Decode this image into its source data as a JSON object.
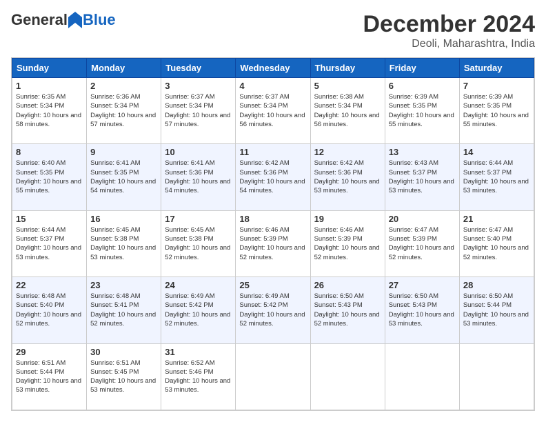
{
  "logo": {
    "general": "General",
    "blue": "Blue"
  },
  "header": {
    "month": "December 2024",
    "location": "Deoli, Maharashtra, India"
  },
  "weekdays": [
    "Sunday",
    "Monday",
    "Tuesday",
    "Wednesday",
    "Thursday",
    "Friday",
    "Saturday"
  ],
  "weeks": [
    [
      {
        "day": "1",
        "sunrise": "6:35 AM",
        "sunset": "5:34 PM",
        "daylight": "10 hours and 58 minutes."
      },
      {
        "day": "2",
        "sunrise": "6:36 AM",
        "sunset": "5:34 PM",
        "daylight": "10 hours and 57 minutes."
      },
      {
        "day": "3",
        "sunrise": "6:37 AM",
        "sunset": "5:34 PM",
        "daylight": "10 hours and 57 minutes."
      },
      {
        "day": "4",
        "sunrise": "6:37 AM",
        "sunset": "5:34 PM",
        "daylight": "10 hours and 56 minutes."
      },
      {
        "day": "5",
        "sunrise": "6:38 AM",
        "sunset": "5:34 PM",
        "daylight": "10 hours and 56 minutes."
      },
      {
        "day": "6",
        "sunrise": "6:39 AM",
        "sunset": "5:35 PM",
        "daylight": "10 hours and 55 minutes."
      },
      {
        "day": "7",
        "sunrise": "6:39 AM",
        "sunset": "5:35 PM",
        "daylight": "10 hours and 55 minutes."
      }
    ],
    [
      {
        "day": "8",
        "sunrise": "6:40 AM",
        "sunset": "5:35 PM",
        "daylight": "10 hours and 55 minutes."
      },
      {
        "day": "9",
        "sunrise": "6:41 AM",
        "sunset": "5:35 PM",
        "daylight": "10 hours and 54 minutes."
      },
      {
        "day": "10",
        "sunrise": "6:41 AM",
        "sunset": "5:36 PM",
        "daylight": "10 hours and 54 minutes."
      },
      {
        "day": "11",
        "sunrise": "6:42 AM",
        "sunset": "5:36 PM",
        "daylight": "10 hours and 54 minutes."
      },
      {
        "day": "12",
        "sunrise": "6:42 AM",
        "sunset": "5:36 PM",
        "daylight": "10 hours and 53 minutes."
      },
      {
        "day": "13",
        "sunrise": "6:43 AM",
        "sunset": "5:37 PM",
        "daylight": "10 hours and 53 minutes."
      },
      {
        "day": "14",
        "sunrise": "6:44 AM",
        "sunset": "5:37 PM",
        "daylight": "10 hours and 53 minutes."
      }
    ],
    [
      {
        "day": "15",
        "sunrise": "6:44 AM",
        "sunset": "5:37 PM",
        "daylight": "10 hours and 53 minutes."
      },
      {
        "day": "16",
        "sunrise": "6:45 AM",
        "sunset": "5:38 PM",
        "daylight": "10 hours and 53 minutes."
      },
      {
        "day": "17",
        "sunrise": "6:45 AM",
        "sunset": "5:38 PM",
        "daylight": "10 hours and 52 minutes."
      },
      {
        "day": "18",
        "sunrise": "6:46 AM",
        "sunset": "5:39 PM",
        "daylight": "10 hours and 52 minutes."
      },
      {
        "day": "19",
        "sunrise": "6:46 AM",
        "sunset": "5:39 PM",
        "daylight": "10 hours and 52 minutes."
      },
      {
        "day": "20",
        "sunrise": "6:47 AM",
        "sunset": "5:39 PM",
        "daylight": "10 hours and 52 minutes."
      },
      {
        "day": "21",
        "sunrise": "6:47 AM",
        "sunset": "5:40 PM",
        "daylight": "10 hours and 52 minutes."
      }
    ],
    [
      {
        "day": "22",
        "sunrise": "6:48 AM",
        "sunset": "5:40 PM",
        "daylight": "10 hours and 52 minutes."
      },
      {
        "day": "23",
        "sunrise": "6:48 AM",
        "sunset": "5:41 PM",
        "daylight": "10 hours and 52 minutes."
      },
      {
        "day": "24",
        "sunrise": "6:49 AM",
        "sunset": "5:42 PM",
        "daylight": "10 hours and 52 minutes."
      },
      {
        "day": "25",
        "sunrise": "6:49 AM",
        "sunset": "5:42 PM",
        "daylight": "10 hours and 52 minutes."
      },
      {
        "day": "26",
        "sunrise": "6:50 AM",
        "sunset": "5:43 PM",
        "daylight": "10 hours and 52 minutes."
      },
      {
        "day": "27",
        "sunrise": "6:50 AM",
        "sunset": "5:43 PM",
        "daylight": "10 hours and 53 minutes."
      },
      {
        "day": "28",
        "sunrise": "6:50 AM",
        "sunset": "5:44 PM",
        "daylight": "10 hours and 53 minutes."
      }
    ],
    [
      {
        "day": "29",
        "sunrise": "6:51 AM",
        "sunset": "5:44 PM",
        "daylight": "10 hours and 53 minutes."
      },
      {
        "day": "30",
        "sunrise": "6:51 AM",
        "sunset": "5:45 PM",
        "daylight": "10 hours and 53 minutes."
      },
      {
        "day": "31",
        "sunrise": "6:52 AM",
        "sunset": "5:46 PM",
        "daylight": "10 hours and 53 minutes."
      },
      null,
      null,
      null,
      null
    ]
  ]
}
